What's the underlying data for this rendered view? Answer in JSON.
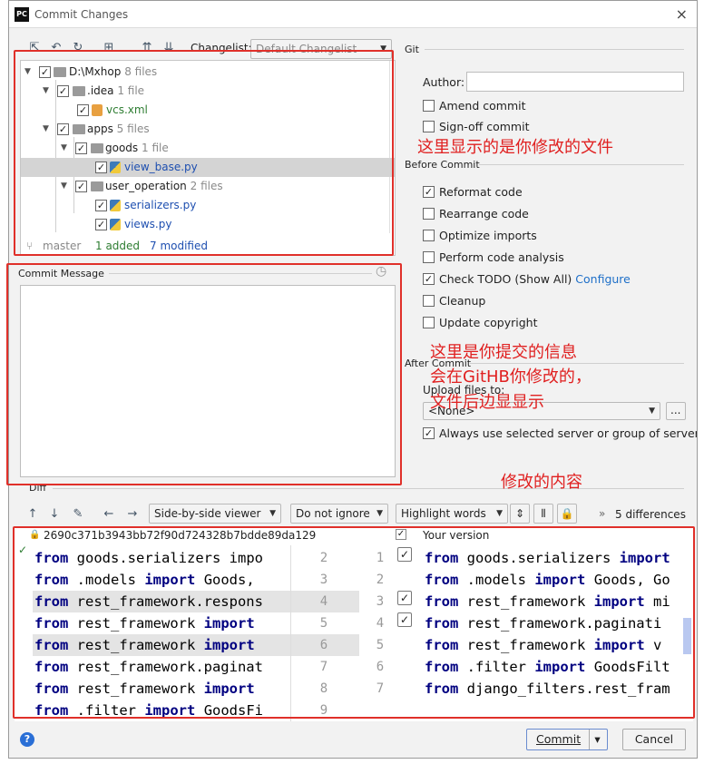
{
  "window": {
    "title": "Commit Changes",
    "close": "×",
    "logo": "PC"
  },
  "toolbar": {
    "changelist_label": "Changelist:",
    "changelist_value": "Default Changelist"
  },
  "git_label": "Git",
  "tree": {
    "rows": [
      {
        "name": "D:\\Mxhop",
        "count": "8 files"
      },
      {
        "name": ".idea",
        "count": "1 file"
      },
      {
        "name": "vcs.xml",
        "count": ""
      },
      {
        "name": "apps",
        "count": "5 files"
      },
      {
        "name": "goods",
        "count": "1 file"
      },
      {
        "name": "view_base.py",
        "count": ""
      },
      {
        "name": "user_operation",
        "count": "2 files"
      },
      {
        "name": "serializers.py",
        "count": ""
      },
      {
        "name": "views.py",
        "count": ""
      }
    ],
    "status": {
      "branch": "master",
      "added": "1 added",
      "modified": "7 modified"
    }
  },
  "commit_message_label": "Commit Message",
  "author_label": "Author:",
  "amend_label": "Amend commit",
  "signoff_label": "Sign-off commit",
  "before_commit_label": "Before Commit",
  "before_options": [
    {
      "label": "Reformat code",
      "checked": true
    },
    {
      "label": "Rearrange code",
      "checked": false
    },
    {
      "label": "Optimize imports",
      "checked": false
    },
    {
      "label": "Perform code analysis",
      "checked": false
    },
    {
      "label": "Check TODO (Show All)",
      "checked": true
    },
    {
      "label": "Cleanup",
      "checked": false
    },
    {
      "label": "Update copyright",
      "checked": false
    }
  ],
  "configure_link": "Configure",
  "after_commit_label": "After Commit",
  "upload_label": "Upload files to:",
  "upload_value": "<None>",
  "upload_more": "...",
  "always_use_label": "Always use selected server or group of servers",
  "diff": {
    "label": "Diff",
    "viewer": "Side-by-side viewer",
    "ignore": "Do not ignore",
    "highlight": "Highlight words",
    "differences": "5 differences",
    "left_header": "2690c371b3943bb72f90d724328b7bdde89da129",
    "right_header": "Your version",
    "left_lines": [
      "from goods.serializers impo",
      "from .models import Goods, ",
      "from rest_framework.respons",
      "from rest_framework import ",
      "from rest_framework import",
      "from rest_framework.paginat",
      "from rest_framework import",
      "from .filter import GoodsFi"
    ],
    "left_nums": [
      "2",
      "3",
      "4",
      "5",
      "6",
      "7",
      "8",
      "9"
    ],
    "right_nums": [
      "1",
      "2",
      "3",
      "4",
      "5",
      "6",
      "7",
      ""
    ],
    "right_lines": [
      "from goods.serializers import",
      "from .models import Goods, Go",
      "from rest_framework import mi",
      "from rest_framework.paginati",
      "from rest_framework import v",
      "from .filter import GoodsFilt",
      "from django_filters.rest_fram",
      ""
    ]
  },
  "annotations": {
    "files": "这里显示的是你修改的文件",
    "message_1": "这里是你提交的信息",
    "message_2": "会在GitHB你修改的，",
    "message_3": "文件后边显显示",
    "diff": "修改的内容"
  },
  "buttons": {
    "commit": "Commit",
    "commit_arrow": "▾",
    "cancel": "Cancel",
    "help": "?"
  },
  "colors": {
    "annotation": "#e02020",
    "keyword": "#000080",
    "added": "#2e7d32",
    "modified": "#1e4fb0"
  }
}
